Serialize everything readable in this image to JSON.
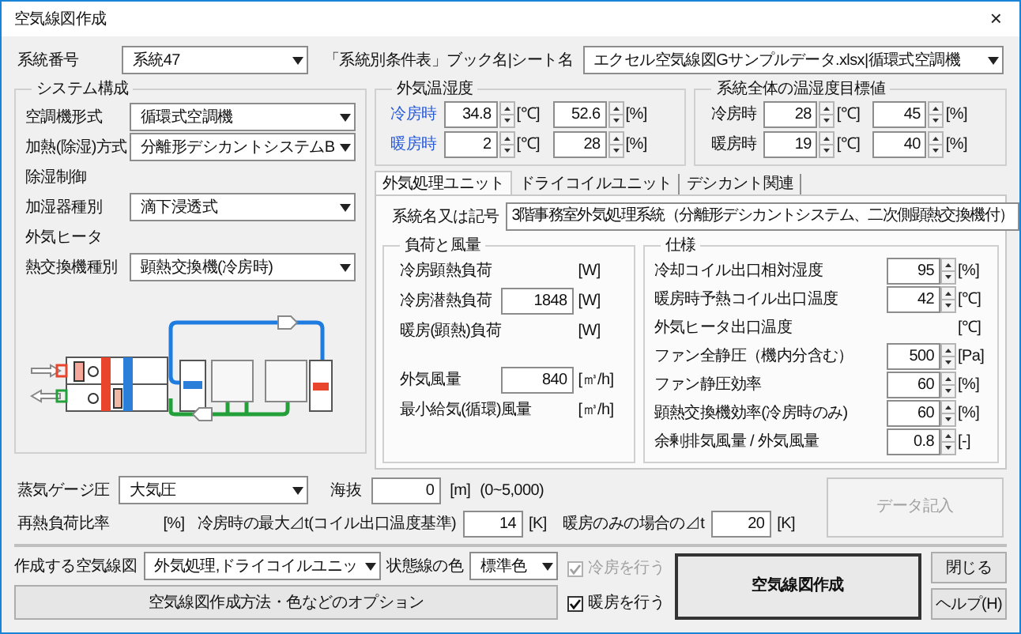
{
  "window": {
    "title": "空気線図作成",
    "close": "×"
  },
  "system_number": {
    "label": "系統番号",
    "value": "系統47"
  },
  "sheet": {
    "label": "「系統別条件表」ブック名|シート名",
    "value": "エクセル空気線図Gサンプルデータ.xlsx|循環式空調機"
  },
  "system_config": {
    "title": "システム構成",
    "rows": [
      {
        "kind": "select",
        "label": "空調機形式",
        "value": "循環式空調機"
      },
      {
        "kind": "select",
        "label": "加熱(除湿)方式",
        "value": "分離形デシカントシステムB"
      },
      {
        "kind": "label",
        "label": "除湿制御"
      },
      {
        "kind": "select",
        "label": "加湿器種別",
        "value": "滴下浸透式"
      },
      {
        "kind": "label",
        "label": "外気ヒータ"
      },
      {
        "kind": "select",
        "label": "熱交換機種別",
        "value": "顕熱交換機(冷房時)"
      }
    ]
  },
  "outdoor": {
    "title": "外気温湿度",
    "rows": [
      {
        "label": "冷房時",
        "temp": "34.8",
        "temp_unit": "[℃]",
        "humidity": "52.6",
        "humidity_unit": "[%]"
      },
      {
        "label": "暖房時",
        "temp": "2",
        "temp_unit": "[℃]",
        "humidity": "28",
        "humidity_unit": "[%]"
      }
    ]
  },
  "target": {
    "title": "系統全体の温湿度目標値",
    "rows": [
      {
        "label": "冷房時",
        "temp": "28",
        "temp_unit": "[℃]",
        "humidity": "45",
        "humidity_unit": "[%]"
      },
      {
        "label": "暖房時",
        "temp": "19",
        "temp_unit": "[℃]",
        "humidity": "40",
        "humidity_unit": "[%]"
      }
    ]
  },
  "tabs": [
    {
      "label": "外気処理ユニット",
      "selected": true
    },
    {
      "label": "ドライコイルユニット",
      "selected": false
    },
    {
      "label": "デシカント関連",
      "selected": false
    }
  ],
  "system_name": {
    "label": "系統名又は記号",
    "value": "3階事務室外気処理系統（分離形デシカントシステム、二次側顕熱交換機付）"
  },
  "load": {
    "title": "負荷と風量",
    "rows": [
      {
        "label": "冷房顕熱負荷",
        "unit": "[W]"
      },
      {
        "label": "冷房潜熱負荷",
        "value": "1848",
        "unit": "[W]"
      },
      {
        "label": "暖房(顕熱)負荷",
        "unit": "[W]"
      },
      {
        "label": "外気風量",
        "value": "840",
        "unit": "[㎥/h]"
      },
      {
        "label": "最小給気(循環)風量",
        "unit": "[㎥/h]"
      }
    ]
  },
  "spec": {
    "title": "仕様",
    "rows": [
      {
        "label": "冷却コイル出口相対湿度",
        "value": "95",
        "unit": "[%]"
      },
      {
        "label": "暖房時予熱コイル出口温度",
        "value": "42",
        "unit": "[℃]"
      },
      {
        "label": "外気ヒータ出口温度",
        "unit": "[℃]"
      },
      {
        "label": "ファン全静圧（機内分含む）",
        "value": "500",
        "unit": "[Pa]"
      },
      {
        "label": "ファン静圧効率",
        "value": "60",
        "unit": "[%]"
      },
      {
        "label": "顕熱交換機効率(冷房時のみ)",
        "value": "60",
        "unit": "[%]"
      },
      {
        "label": "余剰排気風量 / 外気風量",
        "value": "0.8",
        "unit": "[-]"
      }
    ]
  },
  "steam": {
    "label": "蒸気ゲージ圧",
    "value": "大気圧"
  },
  "altitude": {
    "label": "海抜",
    "value": "0",
    "unit": "[m]",
    "range": "(0~5,000)"
  },
  "reheat": {
    "label": "再熱負荷比率",
    "unit": "[%]"
  },
  "max_dt": {
    "label": "冷房時の最大⊿t(コイル出口温度基準)",
    "value": "14",
    "unit": "[K]"
  },
  "heating_dt": {
    "label": "暖房のみの場合の⊿t",
    "value": "20",
    "unit": "[K]"
  },
  "data_button": {
    "label": "データ記入",
    "disabled": true
  },
  "chart_select": {
    "label": "作成する空気線図",
    "value": "外気処理,ドライコイルユニッ"
  },
  "line_color": {
    "label": "状態線の色",
    "value": "標準色"
  },
  "options_button": "空気線図作成方法・色などのオプション",
  "checkboxes": [
    {
      "label": "冷房を行う",
      "checked": true,
      "disabled": true
    },
    {
      "label": "暖房を行う",
      "checked": true,
      "disabled": false
    }
  ],
  "create_button": "空気線図作成",
  "close_button": "閉じる",
  "help_button": "ヘルプ(H)"
}
